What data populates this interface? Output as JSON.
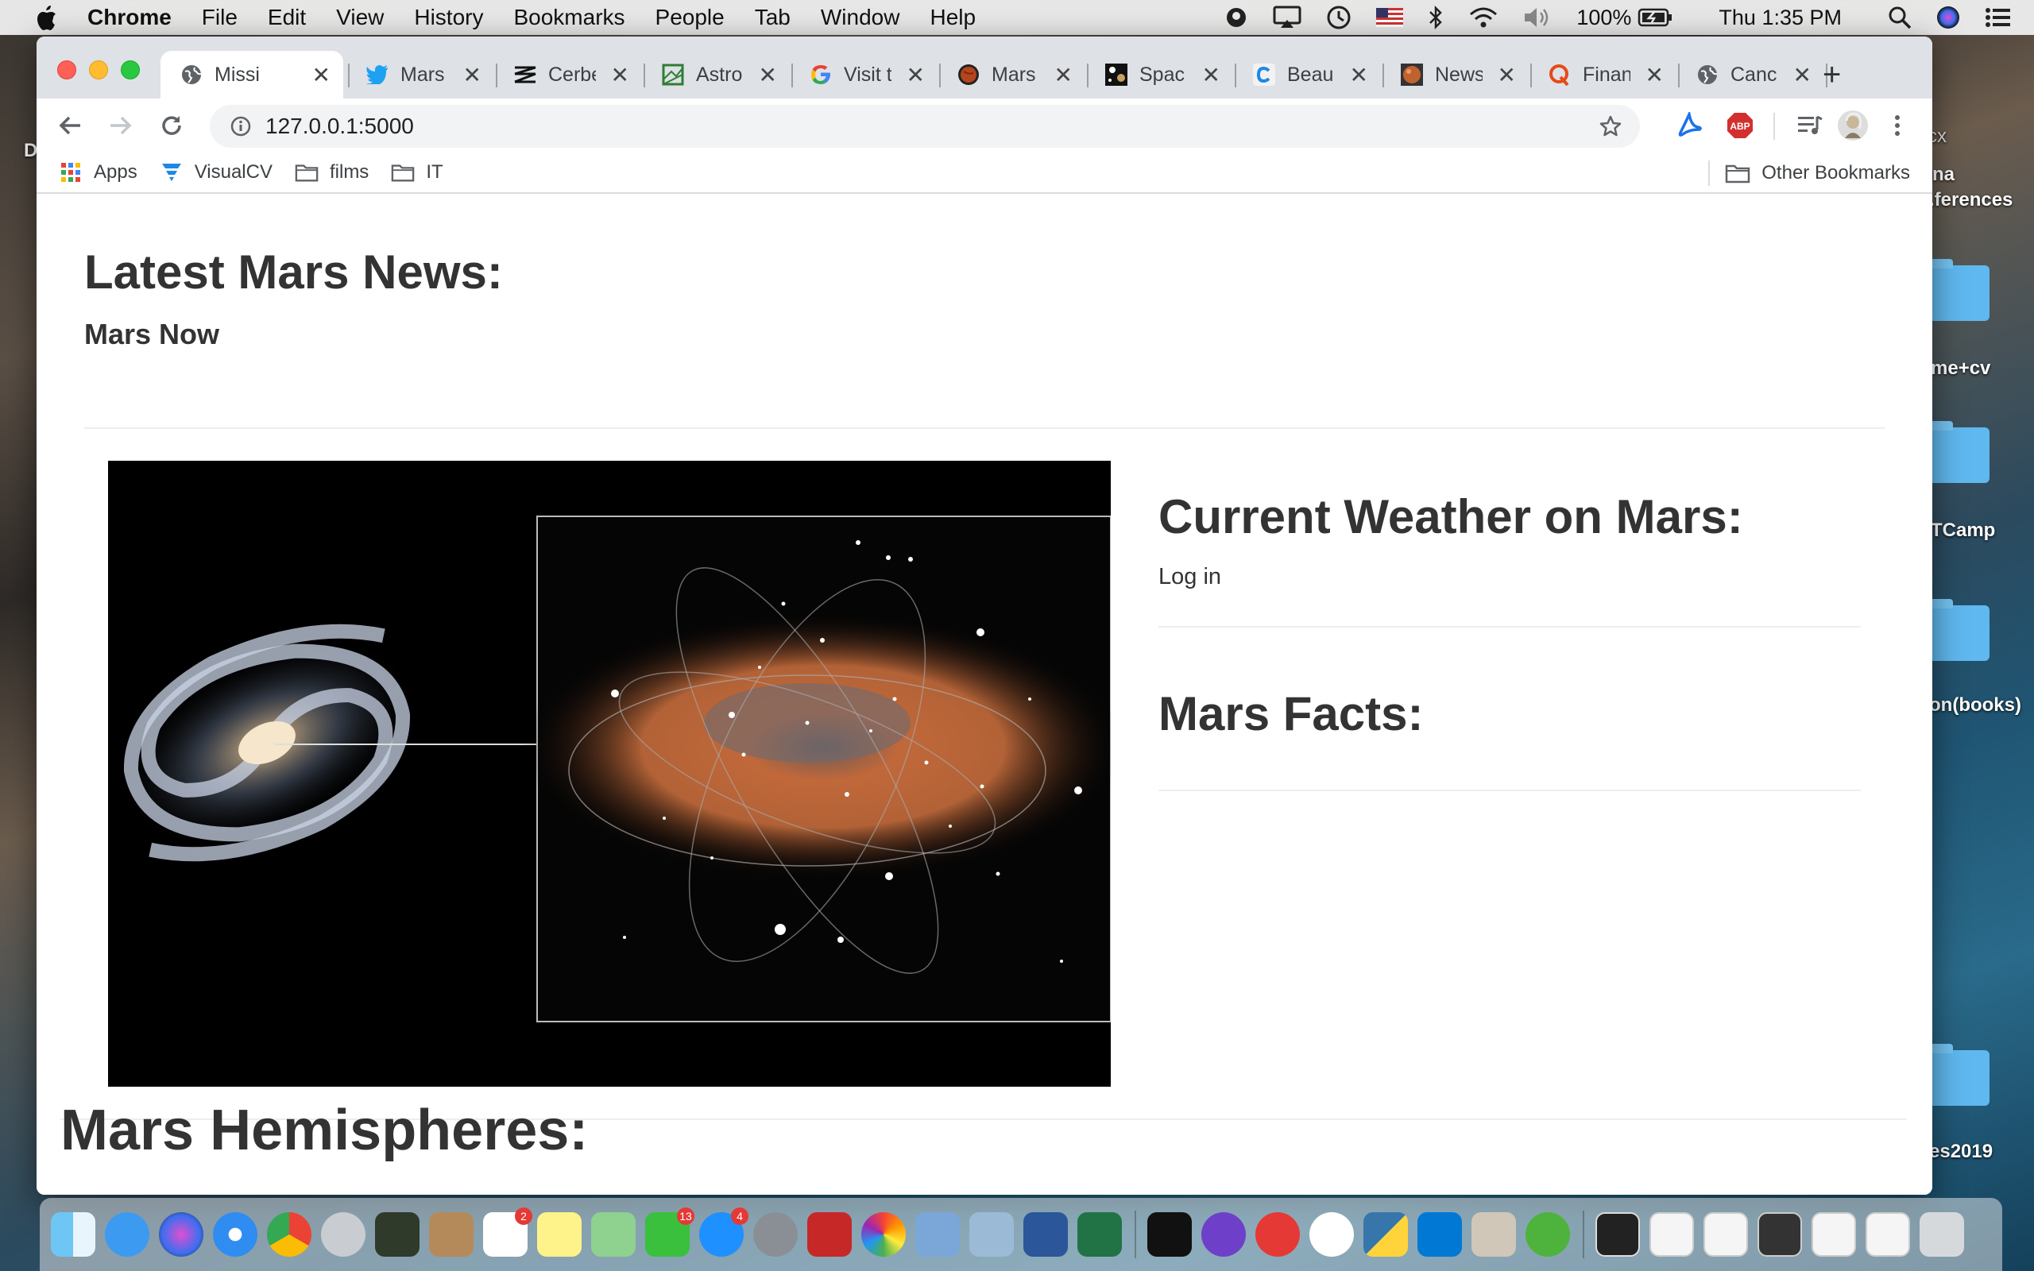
{
  "menubar": {
    "app_name": "Chrome",
    "items": [
      "File",
      "Edit",
      "View",
      "History",
      "Bookmarks",
      "People",
      "Tab",
      "Window",
      "Help"
    ],
    "battery": "100%",
    "clock": "Thu 1:35 PM",
    "icons": [
      "evernote-icon",
      "airplay-icon",
      "time-machine-icon",
      "us-flag-icon",
      "bluetooth-icon",
      "wifi-icon",
      "volume-icon",
      "battery-icon",
      "spotlight-icon",
      "siri-icon",
      "notification-center-icon"
    ]
  },
  "desktop": {
    "items": [
      {
        "label": "na"
      },
      {
        "label": ".ferences"
      },
      {
        "label": "me+cv"
      },
      {
        "label": "TCamp"
      },
      {
        "label": "on(books)"
      },
      {
        "label": "es2019"
      },
      {
        "label": "cx"
      },
      {
        "label": "D"
      }
    ]
  },
  "tabs": [
    {
      "title": "Missi",
      "icon": "globe-icon",
      "active": true
    },
    {
      "title": "Mars",
      "icon": "twitter-icon"
    },
    {
      "title": "Cerbe",
      "icon": "cerberus-icon"
    },
    {
      "title": "Astro",
      "icon": "astro-icon"
    },
    {
      "title": "Visit t",
      "icon": "google-icon"
    },
    {
      "title": "Mars",
      "icon": "mars-icon"
    },
    {
      "title": "Spac",
      "icon": "space-icon"
    },
    {
      "title": "Beau",
      "icon": "c-icon"
    },
    {
      "title": "News",
      "icon": "news-icon"
    },
    {
      "title": "Finan",
      "icon": "quora-icon"
    },
    {
      "title": "Canc",
      "icon": "globe-icon"
    }
  ],
  "toolbar": {
    "url": "127.0.0.1:5000"
  },
  "bookmarks": {
    "items": [
      {
        "label": "Apps",
        "icon": "apps-grid-icon"
      },
      {
        "label": "VisualCV",
        "icon": "visualcv-icon"
      },
      {
        "label": "films",
        "icon": "folder-icon"
      },
      {
        "label": "IT",
        "icon": "folder-icon"
      }
    ],
    "other": "Other Bookmarks"
  },
  "page": {
    "news_title": "Latest Mars News:",
    "news_subtitle": "Mars Now",
    "weather_title": "Current Weather on Mars:",
    "weather_text": "Log in",
    "facts_title": "Mars Facts:",
    "hemispheres_title": "Mars Hemispheres:"
  },
  "dock": {
    "badges": {
      "reminders": "2",
      "messages": "13",
      "app_store": "4"
    }
  }
}
